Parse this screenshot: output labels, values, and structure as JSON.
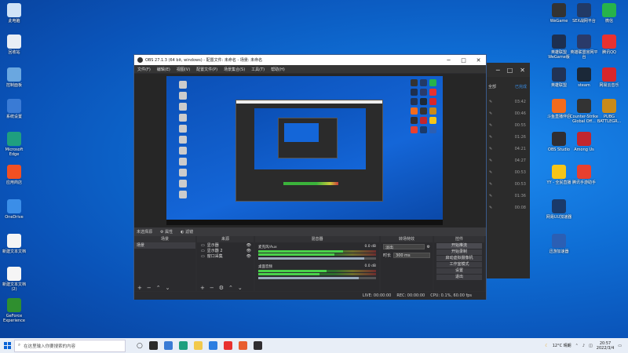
{
  "desktop_left": [
    {
      "id": "pc",
      "label": "此电脑",
      "color": "#cfe3f7"
    },
    {
      "id": "recycle",
      "label": "回收站",
      "color": "#e8eef5"
    },
    {
      "id": "control",
      "label": "控制面板",
      "color": "#6aa7e0"
    },
    {
      "id": "settings",
      "label": "系统设置",
      "color": "#3a7bd5"
    },
    {
      "id": "edge",
      "label": "Microsoft Edge",
      "color": "#1f9f7f"
    },
    {
      "id": "store",
      "label": "应用商店",
      "color": "#f25022"
    },
    {
      "id": "onedrive",
      "label": "OneDrive",
      "color": "#3b8ee8"
    },
    {
      "id": "doc1",
      "label": "新建文本文档",
      "color": "#f5f5f5"
    },
    {
      "id": "doc2",
      "label": "新建文本文档(2)",
      "color": "#f5f5f5"
    },
    {
      "id": "nvidia",
      "label": "GeForce Experience",
      "color": "#2f8f2f"
    }
  ],
  "desktop_right": [
    {
      "id": "wegame",
      "label": "WeGame",
      "color": "#333333"
    },
    {
      "id": "seven",
      "label": "SEX战网平台",
      "color": "#223a66"
    },
    {
      "id": "wechat",
      "label": "微信",
      "color": "#27b34b"
    },
    {
      "id": "lolwg",
      "label": "英雄联盟 WeGame版",
      "color": "#1d2f50"
    },
    {
      "id": "lolqt",
      "label": "英雄联盟官网平台",
      "color": "#2a3a6a"
    },
    {
      "id": "qq",
      "label": "腾讯QQ",
      "color": "#e8312f"
    },
    {
      "id": "lol",
      "label": "英雄联盟",
      "color": "#223355"
    },
    {
      "id": "steam",
      "label": "steam",
      "color": "#1b2838"
    },
    {
      "id": "netease",
      "label": "网易云音乐",
      "color": "#d8262b"
    },
    {
      "id": "douyu",
      "label": "斗鱼直播伴侣",
      "color": "#f26b1d"
    },
    {
      "id": "csgo",
      "label": "Counter-Strike Global Off...",
      "color": "#333333"
    },
    {
      "id": "pubg",
      "label": "PUBG BATTLEGR...",
      "color": "#c98a1a"
    },
    {
      "id": "obs",
      "label": "OBS Studio",
      "color": "#302e31"
    },
    {
      "id": "amongus",
      "label": "Among Us",
      "color": "#c2262e"
    },
    {
      "id": "yy",
      "label": "YY - 全民直播",
      "color": "#f5c518"
    },
    {
      "id": "tencentvm",
      "label": "腾讯手游助手",
      "color": "#e8402f"
    },
    {
      "id": "uu",
      "label": "网易UU加速器",
      "color": "#1a3a6a"
    },
    {
      "id": "bilink",
      "label": "迅游加速器",
      "color": "#2b5fb4"
    }
  ],
  "bg_window": {
    "tab": "全部",
    "tab2": "已完成",
    "rows": [
      "03:42",
      "00:46",
      "00:55",
      "01:26",
      "04:21",
      "04:27",
      "00:53",
      "00:53",
      "01:36",
      "00:08"
    ]
  },
  "obs": {
    "title": "OBS 27.1.3 (64 bit, windows) - 配置文件: 未命名 - 场景: 未命名",
    "menu": [
      "文件(F)",
      "编辑(E)",
      "视图(V)",
      "配置文件(P)",
      "场景集合(S)",
      "工具(T)",
      "帮助(H)"
    ],
    "mini_bar": [
      "未选择源",
      "属性",
      "滤镜"
    ],
    "docks": {
      "scenes_title": "场景",
      "sources_title": "来源",
      "mixer_title": "混音器",
      "trans_title": "转场特效",
      "controls_title": "控件"
    },
    "scene_item": "场景",
    "sources": [
      "显示器",
      "显示器 2",
      "窗口采集"
    ],
    "mixer": [
      {
        "name": "麦克风/Aux",
        "db": "0.0 dB",
        "level": 0.72,
        "fader": 0.9
      },
      {
        "name": "桌面音频",
        "db": "0.0 dB",
        "level": 0.58,
        "fader": 0.85
      }
    ],
    "transition": {
      "type": "淡出",
      "duration_label": "时长",
      "duration": "300 ms"
    },
    "controls": [
      "开始推流",
      "开始录制",
      "启动虚拟摄像机",
      "工作室模式",
      "设置",
      "退出"
    ],
    "status": [
      "LIVE: 00:00:00",
      "REC: 00:00:00",
      "CPU: 0.1%, 60.00 fps"
    ]
  },
  "taskbar": {
    "search_placeholder": "在这里输入你要搜索的内容",
    "weather": "12°C 晴朗",
    "time": "20:57",
    "date": "2022/3/4",
    "apps": [
      "#2b2b2b",
      "#3a7bd5",
      "#1f9f7f",
      "#f2c94c",
      "#2a7de1",
      "#e8312f",
      "#e85d2f",
      "#302e31"
    ]
  }
}
